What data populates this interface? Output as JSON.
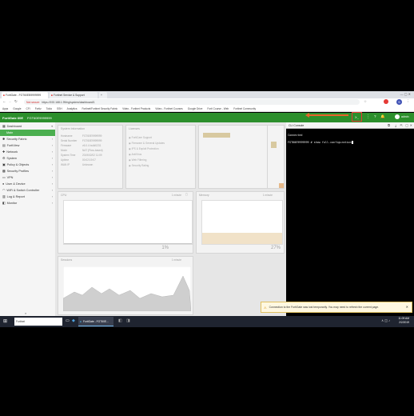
{
  "browser": {
    "tabs": [
      {
        "label": "FortiGate - FGT60EB9999999"
      },
      {
        "label": "Fortinet Service & Support"
      },
      {
        "label": ""
      }
    ],
    "security_label": "Not secure",
    "url": "https://192.168.1.99/ng/system/dashboard/1",
    "bookmarks": [
      "Apps",
      "Google",
      "CFI",
      "Fortiz",
      "Tokio",
      "SSH",
      "Analytics",
      "Fortinet/Fortinet Security Fabric",
      "Video - Fortinet Products",
      "Video - Fortinet Courses",
      "Google Drive",
      "Forti Course - Web",
      "Fortinet Community"
    ],
    "profile_initial": "S"
  },
  "fortigate": {
    "logo": "FortiGate 60E",
    "hostname": "FGT60E9999999",
    "user": "admin"
  },
  "sidebar": {
    "items": [
      {
        "label": "Dashboard",
        "chev": "▾",
        "active": false
      },
      {
        "label": "Main",
        "chev": "",
        "active": true
      },
      {
        "label": "Security Fabric",
        "chev": "›",
        "active": false
      },
      {
        "label": "FortiView",
        "chev": "›",
        "active": false
      },
      {
        "label": "Network",
        "chev": "›",
        "active": false
      },
      {
        "label": "System",
        "chev": "›",
        "active": false
      },
      {
        "label": "Policy & Objects",
        "chev": "›",
        "active": false
      },
      {
        "label": "Security Profiles",
        "chev": "›",
        "active": false
      },
      {
        "label": "VPN",
        "chev": "›",
        "active": false
      },
      {
        "label": "User & Device",
        "chev": "›",
        "active": false
      },
      {
        "label": "WiFi & Switch Controller",
        "chev": "›",
        "active": false
      },
      {
        "label": "Log & Report",
        "chev": "›",
        "active": false
      },
      {
        "label": "Monitor",
        "chev": "›",
        "active": false
      }
    ]
  },
  "dashboard": {
    "system_info": {
      "title": "System Information",
      "rows": [
        {
          "k": "Hostname",
          "v": "FGT60E9999999"
        },
        {
          "k": "Serial Number",
          "v": "FGT60E9999999"
        },
        {
          "k": "Firmware",
          "v": "v6.0.4 build0231"
        },
        {
          "k": "Mode",
          "v": "NAT (Flow-based)"
        },
        {
          "k": "System Time",
          "v": "2019/02/02 11:09"
        },
        {
          "k": "Uptime",
          "v": "00:02:19:07"
        },
        {
          "k": "WAN IP",
          "v": "Unknown"
        }
      ]
    },
    "licenses": {
      "title": "Licenses",
      "items": [
        "FortiCare Support",
        "Firmware & General Updates",
        "IPS & Exploit Protection",
        "AntiVirus",
        "Web Filtering",
        "Security Rating"
      ]
    },
    "cpu": {
      "title": "CPU",
      "range": "1 minute",
      "value": "1%"
    },
    "memory": {
      "title": "Memory",
      "range": "1 minute",
      "value": "27%"
    },
    "sessions": {
      "title": "Sessions",
      "range": "1 minute"
    }
  },
  "cli": {
    "title": "CLI Console",
    "lines": [
      "Connected",
      "FGT60E9999999 # show full-configuration"
    ]
  },
  "notice": {
    "text": "Connection to the FortiGate was lost temporarily. You may need to refresh the current page."
  },
  "taskbar": {
    "search": "Fortinet",
    "window_title": "FortiGate - FGT60E...",
    "time": "11:09 AM",
    "date": "2/2/2019"
  },
  "colors": {
    "brand_green": "#2c8f2c",
    "active_nav": "#4caf50",
    "highlight_box": "#e53935",
    "arrow": "#e8632b"
  }
}
